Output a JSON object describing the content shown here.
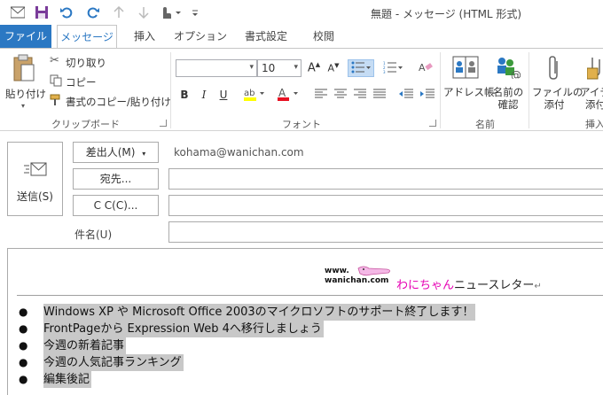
{
  "window": {
    "title": "無題 - メッセージ (HTML 形式)"
  },
  "tabs": [
    {
      "label": "ファイル"
    },
    {
      "label": "メッセージ"
    },
    {
      "label": "挿入"
    },
    {
      "label": "オプション"
    },
    {
      "label": "書式設定"
    },
    {
      "label": "校閲"
    }
  ],
  "ribbon": {
    "clipboard": {
      "paste_label": "貼り付け",
      "cut_label": "切り取り",
      "copy_label": "コピー",
      "format_painter_label": "書式のコピー/貼り付け",
      "group_label": "クリップボード"
    },
    "font": {
      "font_name": "",
      "font_size": "10",
      "group_label": "フォント"
    },
    "names": {
      "address_book_label": "アドレス帳",
      "check_names_line1": "名前の",
      "check_names_line2": "確認",
      "group_label": "名前"
    },
    "insert": {
      "attach_file_line1": "ファイルの",
      "attach_file_line2": "添付",
      "attach_item_line1": "アイテ",
      "attach_item_line2": "添付",
      "group_label": "挿入"
    }
  },
  "compose": {
    "send_label": "送信(S)",
    "from_label": "差出人(M)",
    "from_value": "kohama@wanichan.com",
    "to_label": "宛先...",
    "cc_label": "C C(C)...",
    "subject_label": "件名(U)"
  },
  "body": {
    "logo_line1": "www.",
    "logo_line2": "wanichan.com",
    "newsletter_pink": "わにちゃん",
    "newsletter_rest": "ニュースレター",
    "bullets": [
      "Windows XP や Microsoft Office 2003のマイクロソフトのサポート終了します！",
      "FrontPageから Expression Web 4へ移行しましょう",
      "今週の新着記事",
      "今週の人気記事ランキング",
      "編集後記"
    ]
  },
  "colors": {
    "file_tab": "#2b78c3",
    "highlight": "#ffff00",
    "font_color": "#e81123",
    "logo_pink": "#e600b4"
  }
}
